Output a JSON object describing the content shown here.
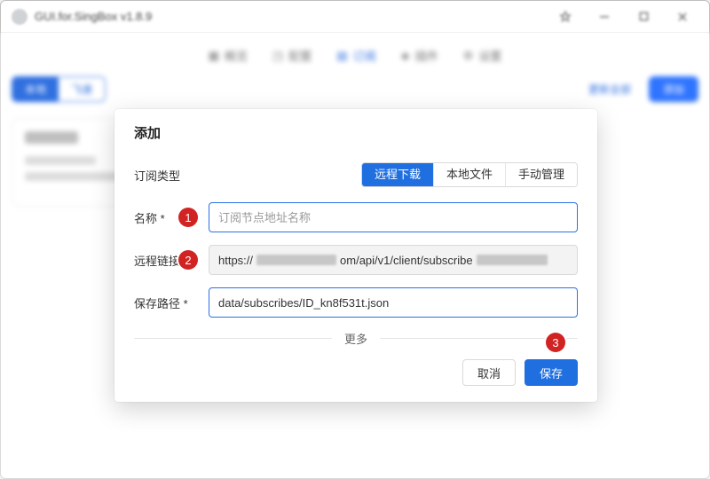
{
  "window": {
    "title": "GUI.for.SingBox v1.8.9"
  },
  "bg": {
    "tabs": [
      "概览",
      "配置",
      "订阅",
      "插件",
      "设置"
    ],
    "active_tab_index": 2,
    "subtab_active": "本地",
    "subtab_inactive": "飞速",
    "refresh_all": "更新全部",
    "primary_btn": "添加"
  },
  "modal": {
    "title": "添加",
    "type_label": "订阅类型",
    "seg": {
      "remote": "远程下载",
      "local": "本地文件",
      "manual": "手动管理"
    },
    "name_label": "名称 *",
    "name_placeholder": "订阅节点地址名称",
    "link_label": "远程链接 *",
    "link_value_prefix": "https://",
    "link_value_mid": "om/api/v1/client/subscribe",
    "path_label": "保存路径 *",
    "path_value": "data/subscribes/ID_kn8f531t.json",
    "more": "更多",
    "cancel": "取消",
    "save": "保存",
    "bullets": {
      "one": "1",
      "two": "2",
      "three": "3"
    }
  }
}
